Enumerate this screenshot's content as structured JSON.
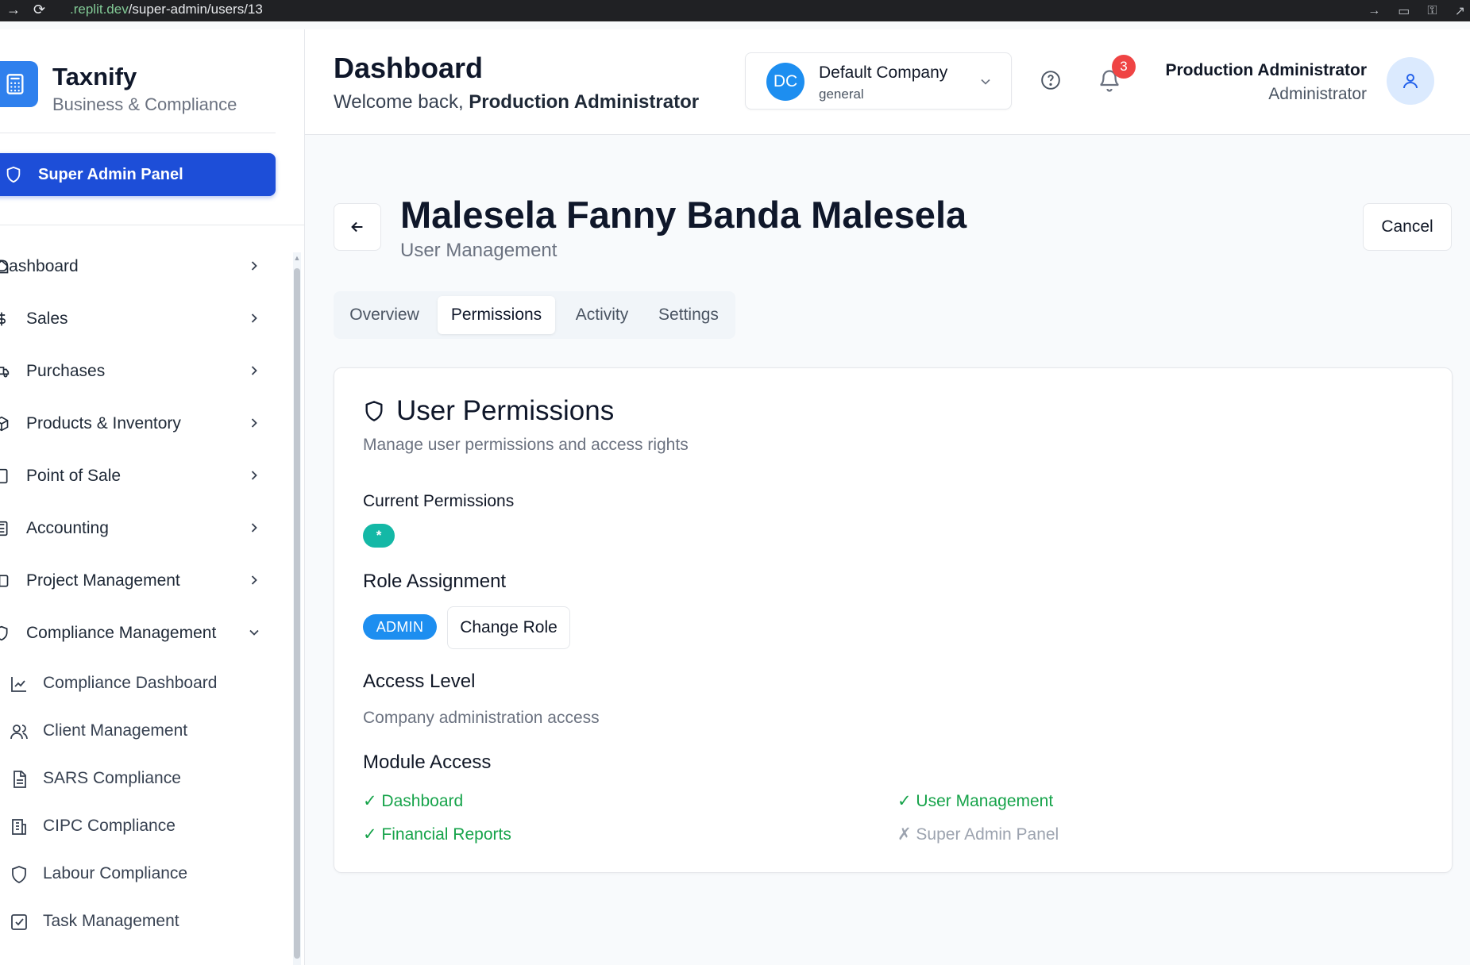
{
  "browser": {
    "url_host": ".replit.dev",
    "url_path": "/super-admin/users/13"
  },
  "brand": {
    "title": "Taxnify",
    "subtitle": "Business & Compliance"
  },
  "sidebar": {
    "super_admin_label": "Super Admin Panel",
    "items": [
      {
        "label": "Dashboard",
        "icon": "home-icon"
      },
      {
        "label": "Sales",
        "icon": "dollar-icon"
      },
      {
        "label": "Purchases",
        "icon": "truck-icon"
      },
      {
        "label": "Products & Inventory",
        "icon": "package-icon"
      },
      {
        "label": "Point of Sale",
        "icon": "tablet-icon"
      },
      {
        "label": "Accounting",
        "icon": "calculator-icon"
      },
      {
        "label": "Project Management",
        "icon": "folder-icon"
      },
      {
        "label": "Compliance Management",
        "icon": "shield-icon"
      }
    ],
    "sub_items": [
      {
        "label": "Compliance Dashboard",
        "icon": "chart-icon"
      },
      {
        "label": "Client Management",
        "icon": "users-icon"
      },
      {
        "label": "SARS Compliance",
        "icon": "document-icon"
      },
      {
        "label": "CIPC Compliance",
        "icon": "building-icon"
      },
      {
        "label": "Labour Compliance",
        "icon": "shield-icon"
      },
      {
        "label": "Task Management",
        "icon": "checkbox-icon"
      }
    ]
  },
  "header": {
    "title": "Dashboard",
    "welcome_prefix": "Welcome back, ",
    "welcome_name": "Production Administrator",
    "company": {
      "initials": "DC",
      "name": "Default Company",
      "type": "general"
    },
    "notification_count": "3",
    "user": {
      "name": "Production Administrator",
      "role": "Administrator"
    }
  },
  "page": {
    "title": "Malesela Fanny Banda Malesela",
    "subtitle": "User Management",
    "cancel_label": "Cancel"
  },
  "tabs": [
    {
      "label": "Overview",
      "active": false
    },
    {
      "label": "Permissions",
      "active": true
    },
    {
      "label": "Activity",
      "active": false
    },
    {
      "label": "Settings",
      "active": false
    }
  ],
  "permissions": {
    "title": "User Permissions",
    "description": "Manage user permissions and access rights",
    "current_label": "Current Permissions",
    "current_badge": "*",
    "role_label": "Role Assignment",
    "role_badge": "ADMIN",
    "change_role_label": "Change Role",
    "access_label": "Access Level",
    "access_text": "Company administration access",
    "module_label": "Module Access",
    "modules": [
      {
        "label": "✓ Dashboard",
        "allowed": true
      },
      {
        "label": "✓ User Management",
        "allowed": true
      },
      {
        "label": "✓ Financial Reports",
        "allowed": true
      },
      {
        "label": "✗ Super Admin Panel",
        "allowed": false
      }
    ]
  },
  "colors": {
    "primary": "#1d4ed8",
    "accent_blue": "#1d8ef0",
    "teal": "#14b8a6",
    "success": "#16a34a",
    "danger": "#ef4444"
  }
}
